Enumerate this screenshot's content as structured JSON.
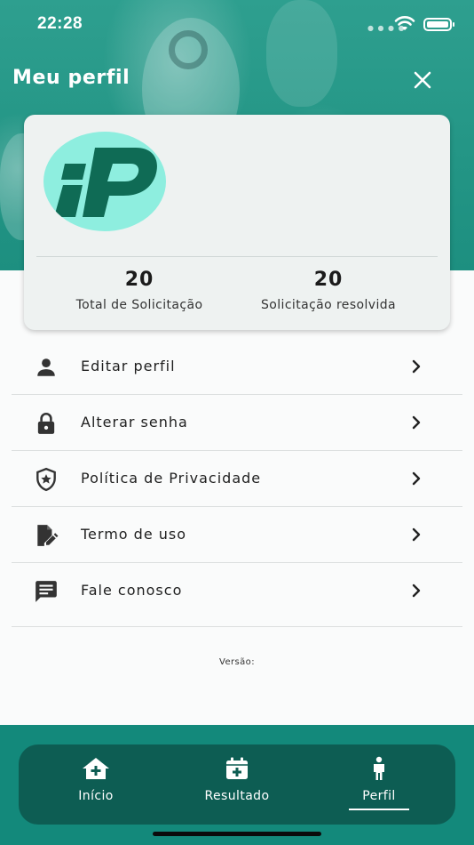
{
  "status_bar": {
    "time": "22:28"
  },
  "header": {
    "title": "Meu perfil",
    "close_icon": "close-icon"
  },
  "profile_card": {
    "logo_icon": "ip-logo",
    "stats": [
      {
        "value": "20",
        "label": "Total de Solicitação"
      },
      {
        "value": "20",
        "label": "Solicitação resolvida"
      }
    ]
  },
  "menu": {
    "items": [
      {
        "label": "Editar perfil",
        "icon": "person-icon"
      },
      {
        "label": "Alterar senha",
        "icon": "lock-icon"
      },
      {
        "label": "Política de Privacidade",
        "icon": "shield-star-icon"
      },
      {
        "label": "Termo de uso",
        "icon": "document-edit-icon"
      },
      {
        "label": "Fale conosco",
        "icon": "chat-icon"
      }
    ]
  },
  "version_label": "Versão:",
  "bottom_nav": {
    "items": [
      {
        "label": "Início",
        "icon": "home-plus-icon"
      },
      {
        "label": "Resultado",
        "icon": "calendar-plus-icon"
      },
      {
        "label": "Perfil",
        "icon": "person-standing-icon",
        "active": true
      }
    ]
  },
  "colors": {
    "primary": "#1d8f80",
    "nav_dark": "#0d5d53",
    "logo_bg": "#8eeedf",
    "logo_fg": "#0f6b55"
  }
}
